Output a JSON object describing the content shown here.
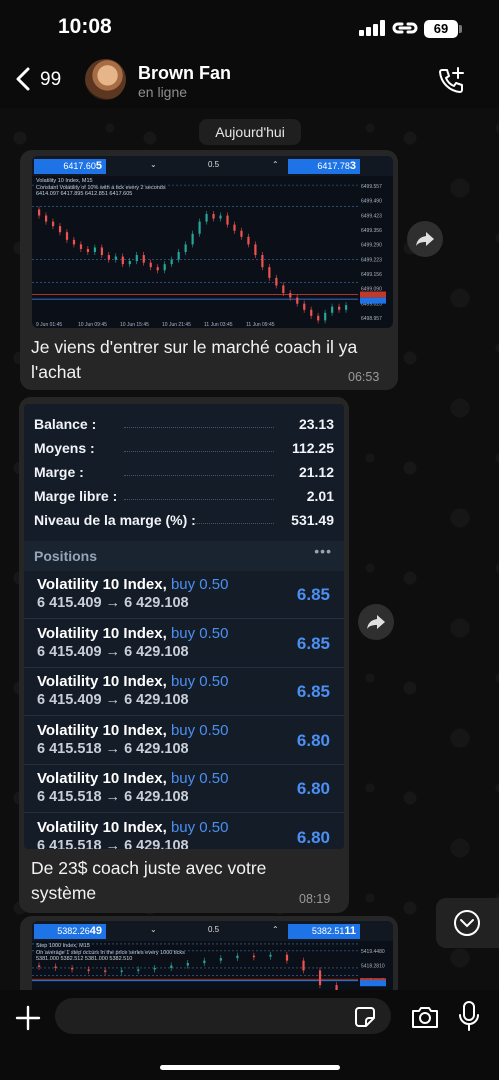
{
  "status_bar": {
    "time": "10:08",
    "battery": "69"
  },
  "header": {
    "back_count": "99",
    "contact_name": "Brown Fan",
    "contact_status": "en ligne"
  },
  "date_divider": "Aujourd'hui",
  "messages": [
    {
      "text": "Je viens d'entrer  sur le marché  coach il ya l'achat",
      "time": "06:53",
      "chart": {
        "sell_price": "6417.60",
        "sell_pip": "5",
        "buy_price": "6417.78",
        "buy_pip": "3",
        "lot": "0.5",
        "info": [
          "Volatility 10 Index, M15",
          "Constant Volatility of 10% with a tick every 2 seconds",
          "6414.097 6417.895 6412.851 6417.605"
        ],
        "price_labels": [
          "6499.557",
          "6499.490",
          "6499.423",
          "6499.356",
          "6499.290",
          "6499.223",
          "6499.156",
          "6499.090",
          "6499.023",
          "6498.957"
        ],
        "time_labels": [
          "9 Jun 01:45",
          "10 Jun 09:45",
          "10 Jun 15:45",
          "10 Jun 21:45",
          "11 Jun 03:45",
          "11 Jun 09:45"
        ]
      }
    },
    {
      "text": "De 23$ coach  juste avec votre système",
      "time": "08:19",
      "account": {
        "rows": [
          {
            "label": "Balance :",
            "value": "23.13"
          },
          {
            "label": "Moyens :",
            "value": "112.25"
          },
          {
            "label": "Marge :",
            "value": "21.12"
          },
          {
            "label": "Marge libre :",
            "value": "2.01"
          },
          {
            "label": "Niveau de la marge (%) :",
            "value": "531.49"
          }
        ],
        "positions_title": "Positions",
        "positions": [
          {
            "symbol": "Volatility 10 Index,",
            "side": "buy 0.50",
            "prices": "6 415.409 → 6 429.108",
            "profit": "6.85"
          },
          {
            "symbol": "Volatility 10 Index,",
            "side": "buy 0.50",
            "prices": "6 415.409 → 6 429.108",
            "profit": "6.85"
          },
          {
            "symbol": "Volatility 10 Index,",
            "side": "buy 0.50",
            "prices": "6 415.409 → 6 429.108",
            "profit": "6.85"
          },
          {
            "symbol": "Volatility 10 Index,",
            "side": "buy 0.50",
            "prices": "6 415.518 → 6 429.108",
            "profit": "6.80"
          },
          {
            "symbol": "Volatility 10 Index,",
            "side": "buy 0.50",
            "prices": "6 415.518 → 6 429.108",
            "profit": "6.80"
          },
          {
            "symbol": "Volatility 10 Index,",
            "side": "buy 0.50",
            "prices": "6 415.518 → 6 429.108",
            "profit": "6.80"
          }
        ]
      }
    },
    {
      "chart": {
        "sell_price": "5382.26",
        "sell_pip": "49",
        "buy_price": "5382.51",
        "buy_pip": "11",
        "lot": "0.5",
        "info": [
          "Step 1000 Index, M15",
          "On average 1 step occurs in the price series every 1000 ticks",
          "5381.000 5382.512 5381.000 5382.510"
        ],
        "price_labels": [
          "5419.4480",
          "5418.2810",
          "5417.1140"
        ]
      }
    }
  ],
  "composer": {
    "placeholder": ""
  },
  "colors": {
    "accent_blue": "#4b8ff2",
    "bubble": "#262626",
    "chart_bg": "#0b1018"
  }
}
